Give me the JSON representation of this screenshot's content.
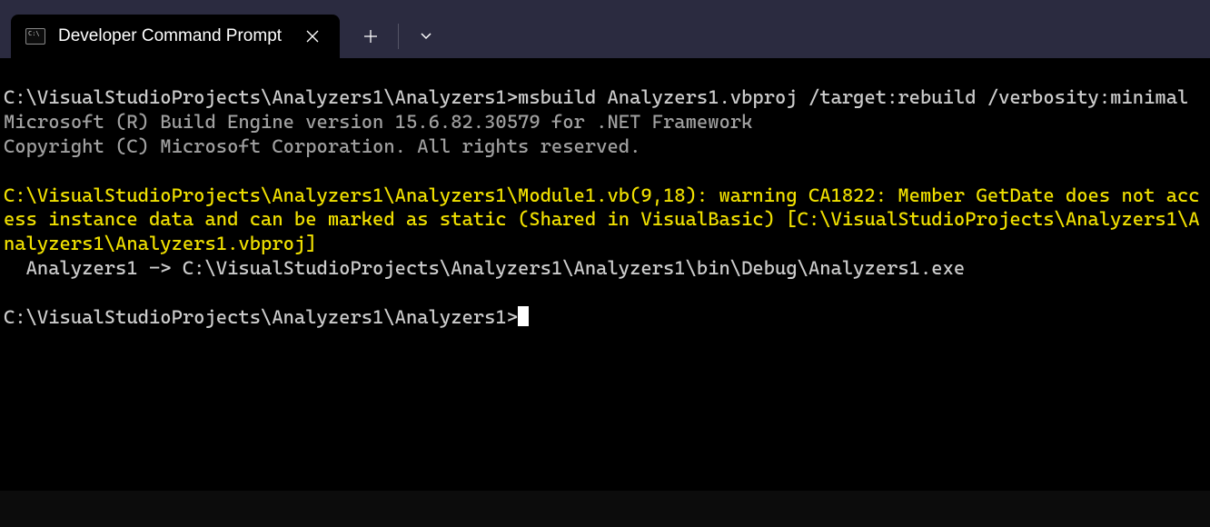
{
  "tab": {
    "title": "Developer Command Prompt",
    "icon_text": "C:\\"
  },
  "terminal": {
    "line1_prompt": "C:\\VisualStudioProjects\\Analyzers1\\Analyzers1>",
    "line1_command": "msbuild Analyzers1.vbproj /target:rebuild /verbosity:minimal",
    "line2": "Microsoft (R) Build Engine version 15.6.82.30579 for .NET Framework",
    "line3": "Copyright (C) Microsoft Corporation. All rights reserved.",
    "warning": "C:\\VisualStudioProjects\\Analyzers1\\Analyzers1\\Module1.vb(9,18): warning CA1822: Member GetDate does not access instance data and can be marked as static (Shared in VisualBasic) [C:\\VisualStudioProjects\\Analyzers1\\Analyzers1\\Analyzers1.vbproj]",
    "build_output": "  Analyzers1 -> C:\\VisualStudioProjects\\Analyzers1\\Analyzers1\\bin\\Debug\\Analyzers1.exe",
    "final_prompt": "C:\\VisualStudioProjects\\Analyzers1\\Analyzers1>"
  }
}
